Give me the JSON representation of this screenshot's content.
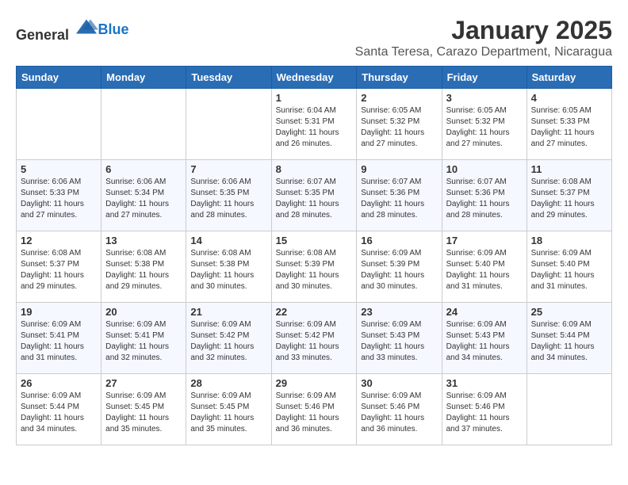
{
  "header": {
    "logo_general": "General",
    "logo_blue": "Blue",
    "month": "January 2025",
    "location": "Santa Teresa, Carazo Department, Nicaragua"
  },
  "weekdays": [
    "Sunday",
    "Monday",
    "Tuesday",
    "Wednesday",
    "Thursday",
    "Friday",
    "Saturday"
  ],
  "weeks": [
    [
      {
        "day": "",
        "sunrise": "",
        "sunset": "",
        "daylight": ""
      },
      {
        "day": "",
        "sunrise": "",
        "sunset": "",
        "daylight": ""
      },
      {
        "day": "",
        "sunrise": "",
        "sunset": "",
        "daylight": ""
      },
      {
        "day": "1",
        "sunrise": "Sunrise: 6:04 AM",
        "sunset": "Sunset: 5:31 PM",
        "daylight": "Daylight: 11 hours and 26 minutes."
      },
      {
        "day": "2",
        "sunrise": "Sunrise: 6:05 AM",
        "sunset": "Sunset: 5:32 PM",
        "daylight": "Daylight: 11 hours and 27 minutes."
      },
      {
        "day": "3",
        "sunrise": "Sunrise: 6:05 AM",
        "sunset": "Sunset: 5:32 PM",
        "daylight": "Daylight: 11 hours and 27 minutes."
      },
      {
        "day": "4",
        "sunrise": "Sunrise: 6:05 AM",
        "sunset": "Sunset: 5:33 PM",
        "daylight": "Daylight: 11 hours and 27 minutes."
      }
    ],
    [
      {
        "day": "5",
        "sunrise": "Sunrise: 6:06 AM",
        "sunset": "Sunset: 5:33 PM",
        "daylight": "Daylight: 11 hours and 27 minutes."
      },
      {
        "day": "6",
        "sunrise": "Sunrise: 6:06 AM",
        "sunset": "Sunset: 5:34 PM",
        "daylight": "Daylight: 11 hours and 27 minutes."
      },
      {
        "day": "7",
        "sunrise": "Sunrise: 6:06 AM",
        "sunset": "Sunset: 5:35 PM",
        "daylight": "Daylight: 11 hours and 28 minutes."
      },
      {
        "day": "8",
        "sunrise": "Sunrise: 6:07 AM",
        "sunset": "Sunset: 5:35 PM",
        "daylight": "Daylight: 11 hours and 28 minutes."
      },
      {
        "day": "9",
        "sunrise": "Sunrise: 6:07 AM",
        "sunset": "Sunset: 5:36 PM",
        "daylight": "Daylight: 11 hours and 28 minutes."
      },
      {
        "day": "10",
        "sunrise": "Sunrise: 6:07 AM",
        "sunset": "Sunset: 5:36 PM",
        "daylight": "Daylight: 11 hours and 28 minutes."
      },
      {
        "day": "11",
        "sunrise": "Sunrise: 6:08 AM",
        "sunset": "Sunset: 5:37 PM",
        "daylight": "Daylight: 11 hours and 29 minutes."
      }
    ],
    [
      {
        "day": "12",
        "sunrise": "Sunrise: 6:08 AM",
        "sunset": "Sunset: 5:37 PM",
        "daylight": "Daylight: 11 hours and 29 minutes."
      },
      {
        "day": "13",
        "sunrise": "Sunrise: 6:08 AM",
        "sunset": "Sunset: 5:38 PM",
        "daylight": "Daylight: 11 hours and 29 minutes."
      },
      {
        "day": "14",
        "sunrise": "Sunrise: 6:08 AM",
        "sunset": "Sunset: 5:38 PM",
        "daylight": "Daylight: 11 hours and 30 minutes."
      },
      {
        "day": "15",
        "sunrise": "Sunrise: 6:08 AM",
        "sunset": "Sunset: 5:39 PM",
        "daylight": "Daylight: 11 hours and 30 minutes."
      },
      {
        "day": "16",
        "sunrise": "Sunrise: 6:09 AM",
        "sunset": "Sunset: 5:39 PM",
        "daylight": "Daylight: 11 hours and 30 minutes."
      },
      {
        "day": "17",
        "sunrise": "Sunrise: 6:09 AM",
        "sunset": "Sunset: 5:40 PM",
        "daylight": "Daylight: 11 hours and 31 minutes."
      },
      {
        "day": "18",
        "sunrise": "Sunrise: 6:09 AM",
        "sunset": "Sunset: 5:40 PM",
        "daylight": "Daylight: 11 hours and 31 minutes."
      }
    ],
    [
      {
        "day": "19",
        "sunrise": "Sunrise: 6:09 AM",
        "sunset": "Sunset: 5:41 PM",
        "daylight": "Daylight: 11 hours and 31 minutes."
      },
      {
        "day": "20",
        "sunrise": "Sunrise: 6:09 AM",
        "sunset": "Sunset: 5:41 PM",
        "daylight": "Daylight: 11 hours and 32 minutes."
      },
      {
        "day": "21",
        "sunrise": "Sunrise: 6:09 AM",
        "sunset": "Sunset: 5:42 PM",
        "daylight": "Daylight: 11 hours and 32 minutes."
      },
      {
        "day": "22",
        "sunrise": "Sunrise: 6:09 AM",
        "sunset": "Sunset: 5:42 PM",
        "daylight": "Daylight: 11 hours and 33 minutes."
      },
      {
        "day": "23",
        "sunrise": "Sunrise: 6:09 AM",
        "sunset": "Sunset: 5:43 PM",
        "daylight": "Daylight: 11 hours and 33 minutes."
      },
      {
        "day": "24",
        "sunrise": "Sunrise: 6:09 AM",
        "sunset": "Sunset: 5:43 PM",
        "daylight": "Daylight: 11 hours and 34 minutes."
      },
      {
        "day": "25",
        "sunrise": "Sunrise: 6:09 AM",
        "sunset": "Sunset: 5:44 PM",
        "daylight": "Daylight: 11 hours and 34 minutes."
      }
    ],
    [
      {
        "day": "26",
        "sunrise": "Sunrise: 6:09 AM",
        "sunset": "Sunset: 5:44 PM",
        "daylight": "Daylight: 11 hours and 34 minutes."
      },
      {
        "day": "27",
        "sunrise": "Sunrise: 6:09 AM",
        "sunset": "Sunset: 5:45 PM",
        "daylight": "Daylight: 11 hours and 35 minutes."
      },
      {
        "day": "28",
        "sunrise": "Sunrise: 6:09 AM",
        "sunset": "Sunset: 5:45 PM",
        "daylight": "Daylight: 11 hours and 35 minutes."
      },
      {
        "day": "29",
        "sunrise": "Sunrise: 6:09 AM",
        "sunset": "Sunset: 5:46 PM",
        "daylight": "Daylight: 11 hours and 36 minutes."
      },
      {
        "day": "30",
        "sunrise": "Sunrise: 6:09 AM",
        "sunset": "Sunset: 5:46 PM",
        "daylight": "Daylight: 11 hours and 36 minutes."
      },
      {
        "day": "31",
        "sunrise": "Sunrise: 6:09 AM",
        "sunset": "Sunset: 5:46 PM",
        "daylight": "Daylight: 11 hours and 37 minutes."
      },
      {
        "day": "",
        "sunrise": "",
        "sunset": "",
        "daylight": ""
      }
    ]
  ]
}
